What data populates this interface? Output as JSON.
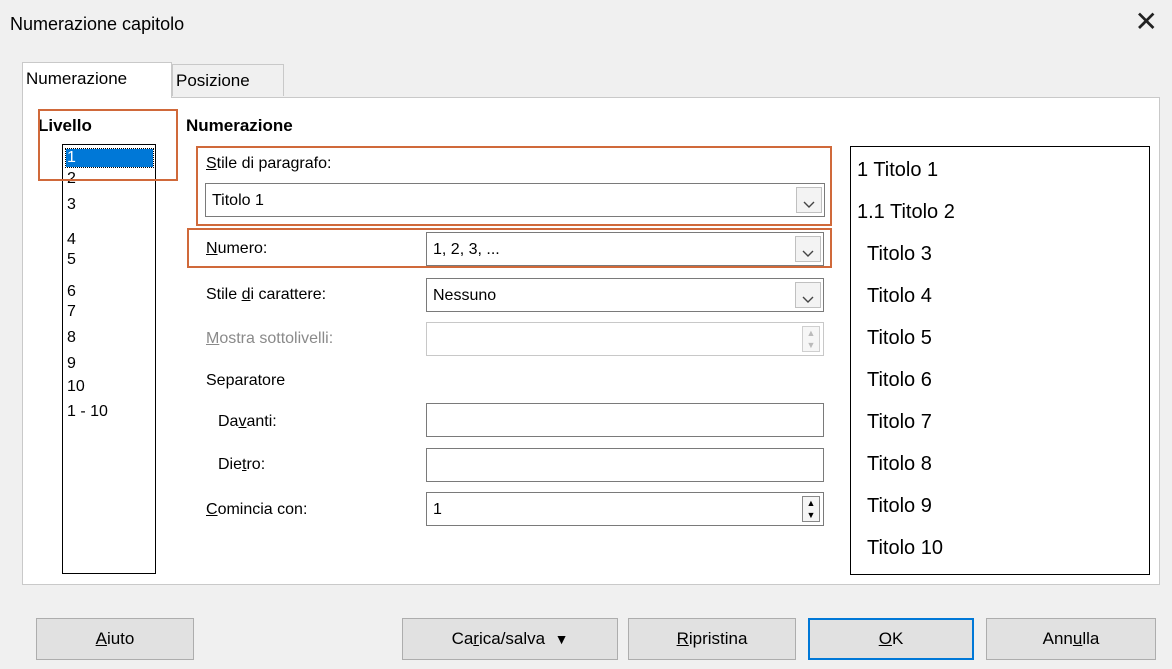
{
  "window": {
    "title": "Numerazione capitolo",
    "close_icon": "close-icon"
  },
  "tabs": [
    {
      "label": "Numerazione",
      "active": true
    },
    {
      "label": "Posizione",
      "active": false
    }
  ],
  "livello": {
    "heading": "Livello",
    "items": [
      "1",
      "2",
      "3",
      "4",
      "5",
      "6",
      "7",
      "8",
      "9",
      "10",
      "1 - 10"
    ],
    "selected": "1"
  },
  "numerazione": {
    "heading": "Numerazione",
    "stile_paragrafo": {
      "label": "Stile di paragrafo:",
      "value": "Titolo 1"
    },
    "numero": {
      "label": "Numero:",
      "value": "1, 2, 3, ..."
    },
    "stile_carattere": {
      "label": "Stile di carattere:",
      "value": "Nessuno"
    },
    "mostra_sottolivelli": {
      "label": "Mostra sottolivelli:",
      "value": ""
    },
    "separatore": {
      "label": "Separatore",
      "davanti": {
        "label": "Davanti:",
        "value": ""
      },
      "dietro": {
        "label": "Dietro:",
        "value": ""
      }
    },
    "comincia_con": {
      "label": "Comincia con:",
      "value": "1"
    }
  },
  "preview": [
    "1 Titolo 1",
    "1.1 Titolo 2",
    "Titolo 3",
    "Titolo 4",
    "Titolo 5",
    "Titolo 6",
    "Titolo 7",
    "Titolo 8",
    "Titolo 9",
    "Titolo 10"
  ],
  "buttons": {
    "aiuto": "Aiuto",
    "carica_salva": "Carica/salva",
    "ripristina": "Ripristina",
    "ok": "OK",
    "annulla": "Annulla"
  },
  "colors": {
    "highlight_box": "#d0693a",
    "selection": "#0078d7",
    "ok_border": "#0078d7"
  }
}
